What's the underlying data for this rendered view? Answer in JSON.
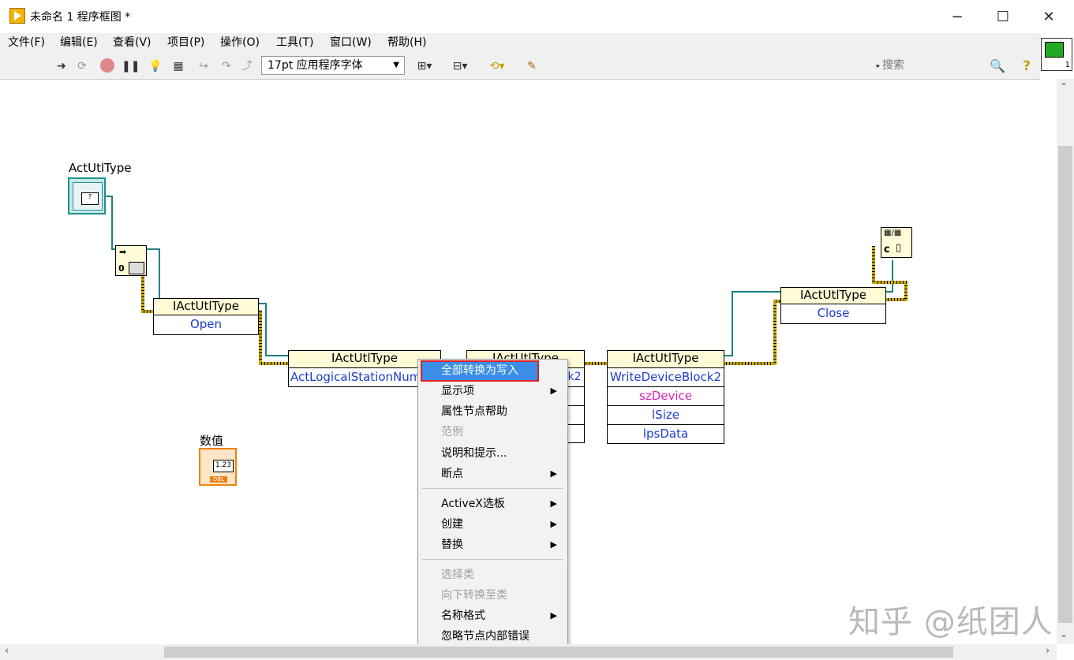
{
  "window": {
    "title": "未命名 1 程序框图 *",
    "minimize": "−",
    "maximize": "☐",
    "close": "✕"
  },
  "menu": [
    "文件(F)",
    "编辑(E)",
    "查看(V)",
    "项目(P)",
    "操作(O)",
    "工具(T)",
    "窗口(W)",
    "帮助(H)"
  ],
  "toolbar": {
    "font": "17pt 应用程序字体",
    "search_placeholder": "搜索",
    "help": "?"
  },
  "diagram": {
    "actutltype_label": "ActUtlType",
    "numeric_label": "数值",
    "numeric_value": "1.23",
    "numeric_type": "DBL",
    "node_open": {
      "class": "IActUtlType",
      "method": "Open"
    },
    "node_prop": {
      "class": "IActUtlType",
      "property": "ActLogicalStationNumb"
    },
    "node_partial": {
      "class": "IActUtlType",
      "method": "k2"
    },
    "node_write": {
      "class": "IActUtlType",
      "method": "WriteDeviceBlock2",
      "params": [
        "szDevice",
        "lSize",
        "lpsData"
      ]
    },
    "node_close": {
      "class": "IActUtlType",
      "method": "Close"
    },
    "close_ref_label": "c"
  },
  "context_menu": {
    "highlighted": "全部转换为写入",
    "items": [
      {
        "label": "显示项",
        "submenu": true,
        "disabled": false
      },
      {
        "label": "属性节点帮助",
        "submenu": false,
        "disabled": false
      },
      {
        "label": "范例",
        "submenu": false,
        "disabled": true
      },
      {
        "label": "说明和提示...",
        "submenu": false,
        "disabled": false
      },
      {
        "label": "断点",
        "submenu": true,
        "disabled": false
      },
      {
        "label": "ActiveX选板",
        "submenu": true,
        "disabled": false
      },
      {
        "label": "创建",
        "submenu": true,
        "disabled": false
      },
      {
        "label": "替换",
        "submenu": true,
        "disabled": false
      },
      {
        "label": "选择类",
        "submenu": false,
        "disabled": true
      },
      {
        "label": "向下转换至类",
        "submenu": false,
        "disabled": true
      },
      {
        "label": "名称格式",
        "submenu": true,
        "disabled": false
      },
      {
        "label": "忽略节点内部错误",
        "submenu": false,
        "disabled": false
      }
    ]
  },
  "watermark": "知乎 @纸团人"
}
